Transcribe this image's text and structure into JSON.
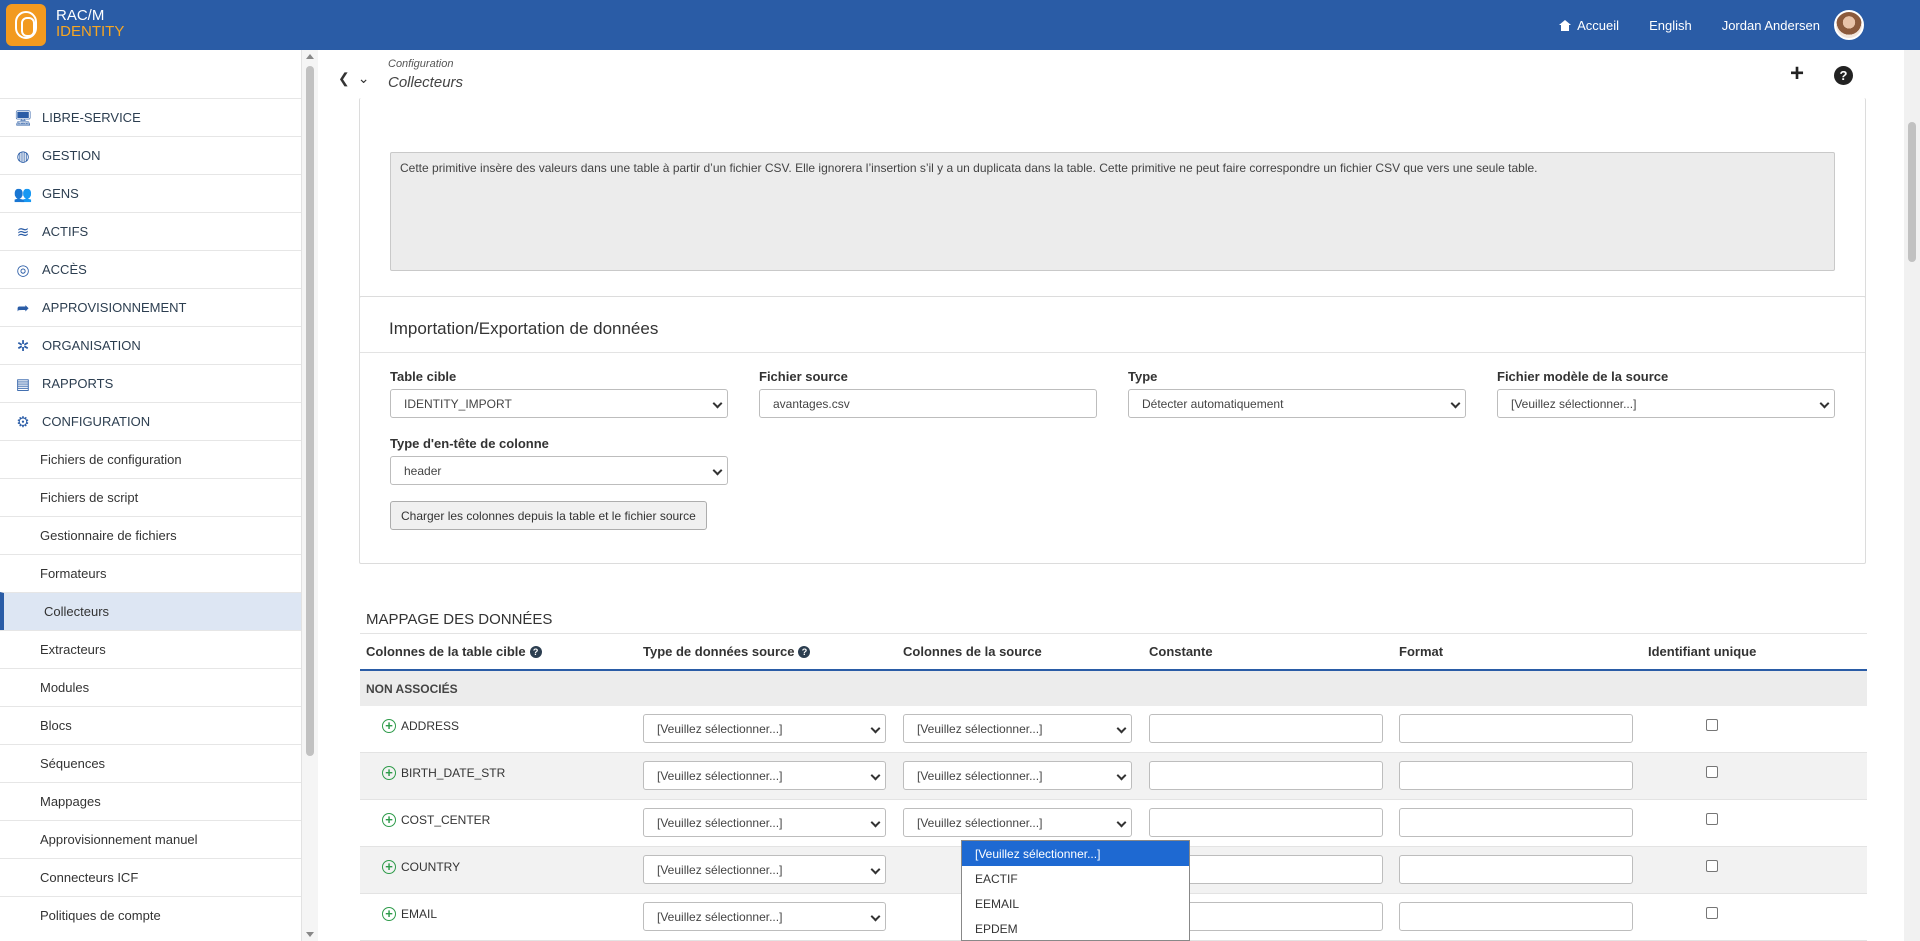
{
  "app": {
    "brand_line1": "RAC/M",
    "brand_line2": "IDENTITY",
    "accent_color": "#2a5ca6"
  },
  "topnav": {
    "home_label": "Accueil",
    "language_label": "English",
    "user_name": "Jordan Andersen"
  },
  "sidebar": {
    "items": [
      {
        "label": "LIBRE-SERVICE",
        "icon": "monitor-icon"
      },
      {
        "label": "GESTION",
        "icon": "dashboard-icon"
      },
      {
        "label": "GENS",
        "icon": "people-icon"
      },
      {
        "label": "ACTIFS",
        "icon": "database-icon"
      },
      {
        "label": "ACCÈS",
        "icon": "fingerprint-icon"
      },
      {
        "label": "APPROVISIONNEMENT",
        "icon": "share-icon"
      },
      {
        "label": "ORGANISATION",
        "icon": "network-icon"
      },
      {
        "label": "RAPPORTS",
        "icon": "document-icon"
      },
      {
        "label": "CONFIGURATION",
        "icon": "gears-icon"
      }
    ],
    "sub_items": [
      "Fichiers de configuration",
      "Fichiers de script",
      "Gestionnaire de fichiers",
      "Formateurs",
      "Collecteurs",
      "Extracteurs",
      "Modules",
      "Blocs",
      "Séquences",
      "Mappages",
      "Approvisionnement manuel",
      "Connecteurs ICF",
      "Politiques de compte"
    ],
    "active_sub": "Collecteurs"
  },
  "header": {
    "breadcrumb_parent": "Configuration",
    "page_title": "Collecteurs"
  },
  "description": {
    "text": "Cette primitive insère des valeurs dans une table à partir d’un fichier CSV. Elle ignorera l’insertion s’il y a un duplicata dans la table. Cette primitive ne peut faire correspondre un fichier CSV que vers une seule table."
  },
  "import_panel": {
    "title": "Importation/Exportation de données",
    "table_cible_label": "Table cible",
    "table_cible_value": "IDENTITY_IMPORT",
    "fichier_source_label": "Fichier source",
    "fichier_source_value": "avantages.csv",
    "type_label": "Type",
    "type_value": "Détecter automatiquement",
    "modele_label": "Fichier modèle de la source",
    "modele_value": "[Veuillez sélectionner...]",
    "entete_label": "Type d'en-tête de colonne",
    "entete_value": "header",
    "load_button": "Charger les colonnes depuis la table et le fichier source"
  },
  "mapping": {
    "title": "MAPPAGE DES DONNÉES",
    "headers": {
      "target_columns": "Colonnes de la table cible",
      "source_type": "Type de données source",
      "source_columns": "Colonnes de la source",
      "constant": "Constante",
      "format": "Format",
      "unique_id": "Identifiant unique"
    },
    "group_label": "NON ASSOCIÉS",
    "placeholder": "[Veuillez sélectionner...]",
    "rows": [
      {
        "name": "ADDRESS"
      },
      {
        "name": "BIRTH_DATE_STR"
      },
      {
        "name": "COST_CENTER"
      },
      {
        "name": "COUNTRY"
      },
      {
        "name": "EMAIL"
      }
    ],
    "open_dropdown_options": [
      "[Veuillez sélectionner...]",
      "EACTIF",
      "EEMAIL",
      "EPDEM"
    ]
  }
}
